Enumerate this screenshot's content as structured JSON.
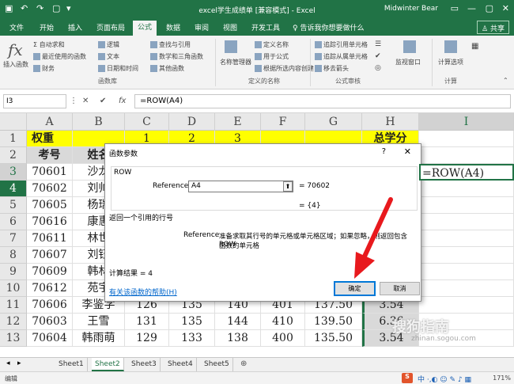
{
  "window": {
    "title": "excel学生成绩单 [兼容模式] - Excel",
    "user": "Midwinter Bear"
  },
  "tabs": [
    "文件",
    "开始",
    "插入",
    "页面布局",
    "公式",
    "数据",
    "审阅",
    "视图",
    "开发工具"
  ],
  "active_tab": "公式",
  "tellme": "告诉我你想要做什么",
  "share": "共享",
  "ribbon": {
    "insert_fn": "插入函数",
    "autosum": "自动求和",
    "recent": "最近使用的函数",
    "financial": "财务",
    "logical": "逻辑",
    "text": "文本",
    "datetime": "日期和时间",
    "lookup": "查找与引用",
    "math": "数学和三角函数",
    "more": "其他函数",
    "lib_group": "函数库",
    "name_mgr": "名称管理器",
    "define_name": "定义名称",
    "use_formula": "用于公式",
    "create_sel": "根据所选内容创建",
    "names_group": "定义的名称",
    "trace_prec": "追踪引用单元格",
    "trace_dep": "追踪从属单元格",
    "remove_arrows": "移去箭头",
    "audit_group": "公式审核",
    "watch": "监视窗口",
    "calc_opts": "计算选项",
    "calc_group": "计算"
  },
  "namebox": "I3",
  "formula": "=ROW(A4)",
  "columns": [
    "A",
    "B",
    "C",
    "D",
    "E",
    "F",
    "G",
    "H",
    "I"
  ],
  "rows": [
    "1",
    "2",
    "3",
    "4",
    "5",
    "6",
    "7",
    "8",
    "9",
    "10",
    "11",
    "12",
    "13"
  ],
  "cells": {
    "r1": [
      "权重",
      "",
      "1",
      "2",
      "3",
      "",
      "",
      "总学分",
      ""
    ],
    "r2": [
      "考号",
      "姓名",
      "",
      "",
      "",
      "",
      "",
      "",
      ""
    ],
    "r3": [
      "70601",
      "沙龙",
      "",
      "",
      "",
      "",
      "",
      "",
      "=ROW(A4)"
    ],
    "r4": [
      "70602",
      "刘帅",
      "",
      "",
      "",
      "",
      "",
      "",
      ""
    ],
    "r5": [
      "70605",
      "杨瑞",
      "",
      "",
      "",
      "",
      "",
      "",
      ""
    ],
    "r6": [
      "70616",
      "康惠",
      "",
      "",
      "",
      "",
      "",
      "",
      ""
    ],
    "r7": [
      "70611",
      "林世",
      "",
      "",
      "",
      "",
      "",
      "",
      ""
    ],
    "r8": [
      "70607",
      "刘钰",
      "",
      "",
      "",
      "",
      "",
      "",
      ""
    ],
    "r9": [
      "70609",
      "韩林",
      "",
      "",
      "",
      "",
      "",
      "",
      ""
    ],
    "r10": [
      "70612",
      "苑宇",
      "",
      "",
      "",
      "",
      "",
      "",
      ""
    ],
    "r11": [
      "70606",
      "李鉴学",
      "126",
      "135",
      "140",
      "401",
      "137.50",
      "3.54",
      ""
    ],
    "r12": [
      "70603",
      "王雪",
      "131",
      "135",
      "144",
      "410",
      "139.50",
      "6.36",
      ""
    ],
    "r13": [
      "70604",
      "韩雨萌",
      "129",
      "133",
      "138",
      "400",
      "135.50",
      "3.54",
      ""
    ]
  },
  "dialog": {
    "title": "函数参数",
    "help_q": "?",
    "close": "✕",
    "fn_name": "ROW",
    "arg_label": "Reference",
    "arg_value": "A4",
    "arg_result": "= 70602",
    "fn_result": "= {4}",
    "desc": "返回一个引用的行号",
    "arg_desc_label": "Reference",
    "arg_desc": "准备求取其行号的单元格或单元格区域；如果忽略，则返回包含 ROW",
    "arg_desc2": "函数的单元格",
    "calc_result": "计算结果 =   4",
    "help_link": "有关该函数的帮助(H)",
    "ok": "确定",
    "cancel": "取消"
  },
  "sheets": [
    "Sheet1",
    "Sheet2",
    "Sheet3",
    "Sheet4",
    "Sheet5"
  ],
  "active_sheet": "Sheet2",
  "status": "编辑",
  "zoom": "171%",
  "watermark": "搜狗指南",
  "watermark_sub": "zhinan.sogou.com"
}
